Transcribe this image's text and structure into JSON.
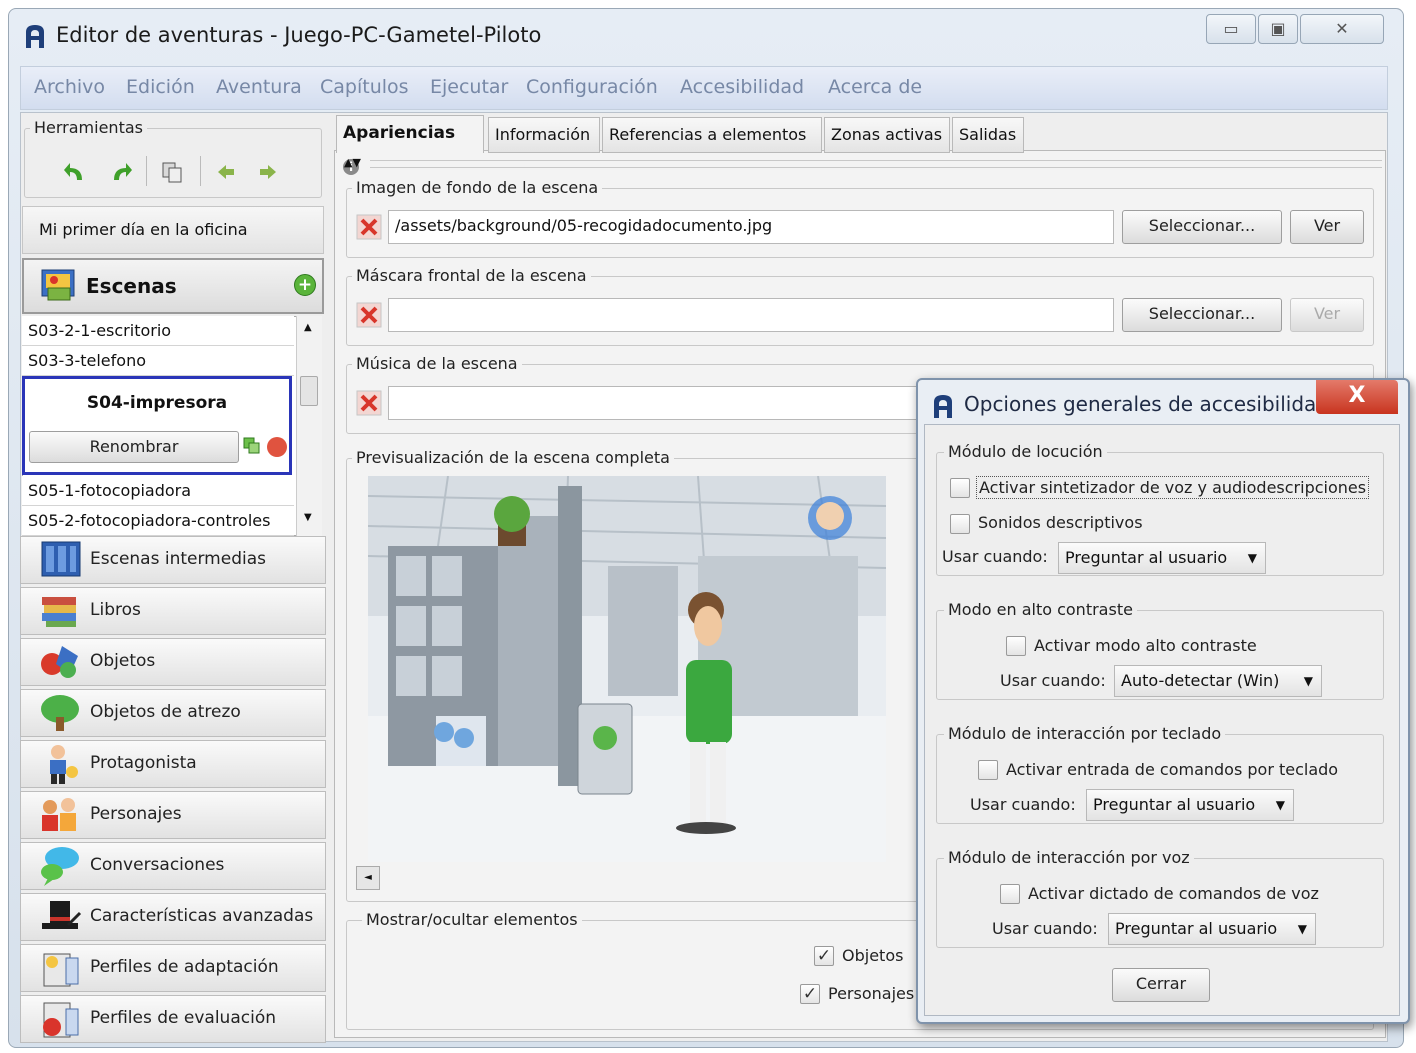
{
  "window": {
    "title": "Editor de aventuras - Juego-PC-Gametel-Piloto",
    "min_glyph": "▭",
    "max_glyph": "▣",
    "close_glyph": "✕"
  },
  "menu": [
    "Archivo",
    "Edición",
    "Aventura",
    "Capítulos",
    "Ejecutar",
    "Configuración",
    "Accesibilidad",
    "Acerca de"
  ],
  "tools": {
    "legend": "Herramientas",
    "icons": [
      "undo-icon",
      "redo-icon",
      "copy-icon",
      "back-icon",
      "forward-icon"
    ]
  },
  "chapter": "Mi primer día en la oficina",
  "scenes": {
    "header": "Escenas",
    "items": [
      "S03-2-1-escritorio",
      "S03-3-telefono"
    ],
    "selected": "S04-impresora",
    "rename": "Renombrar",
    "items_after": [
      "S05-1-fotocopiadora",
      "S05-2-fotocopiadora-controles"
    ]
  },
  "nav": [
    {
      "label": "Escenas intermedias",
      "icon": "film-icon"
    },
    {
      "label": "Libros",
      "icon": "books-icon"
    },
    {
      "label": "Objetos",
      "icon": "objects-icon"
    },
    {
      "label": "Objetos de atrezo",
      "icon": "tree-icon"
    },
    {
      "label": "Protagonista",
      "icon": "player-icon"
    },
    {
      "label": "Personajes",
      "icon": "characters-icon"
    },
    {
      "label": "Conversaciones",
      "icon": "speech-bubble-icon"
    },
    {
      "label": "Características avanzadas",
      "icon": "magic-hat-icon"
    },
    {
      "label": "Perfiles de adaptación",
      "icon": "adaptation-profile-icon"
    },
    {
      "label": "Perfiles de evaluación",
      "icon": "evaluation-profile-icon"
    }
  ],
  "tabs": [
    "Apariencias",
    "Información",
    "Referencias a elementos",
    "Zonas activas",
    "Salidas"
  ],
  "appearance": {
    "background_legend": "Imagen de fondo de la escena",
    "background_path": "/assets/background/05-recogidadocumento.jpg",
    "mask_legend": "Máscara frontal de la escena",
    "mask_path": "",
    "music_legend": "Música de la escena",
    "select_label": "Seleccionar...",
    "view_label": "Ver",
    "preview_legend": "Previsualización de la escena completa",
    "toggle_legend": "Mostrar/ocultar elementos",
    "cb_objects": "Objetos",
    "cb_characters": "Personajes"
  },
  "dialog": {
    "title": "Opciones generales de accesibilidad",
    "close_glyph": "X",
    "speech": {
      "legend": "Módulo de locución",
      "cb1": "Activar sintetizador de voz y audiodescripciones",
      "cb2": "Sonidos descriptivos",
      "use_label": "Usar cuando:",
      "use_value": "Preguntar al usuario"
    },
    "contrast": {
      "legend": "Modo en alto contraste",
      "cb": "Activar modo alto contraste",
      "use_label": "Usar cuando:",
      "use_value": "Auto-detectar (Win)"
    },
    "keyboard": {
      "legend": "Módulo de interacción por teclado",
      "cb": "Activar entrada de comandos por teclado",
      "use_label": "Usar cuando:",
      "use_value": "Preguntar al usuario"
    },
    "voice": {
      "legend": "Módulo de interacción por voz",
      "cb": "Activar dictado de comandos de voz",
      "use_label": "Usar cuando:",
      "use_value": "Preguntar al usuario"
    },
    "close_button": "Cerrar"
  },
  "colors": {
    "accent_selection": "#2a35b8",
    "dialog_close": "#c8341f",
    "menu_text": "#7788a6"
  }
}
